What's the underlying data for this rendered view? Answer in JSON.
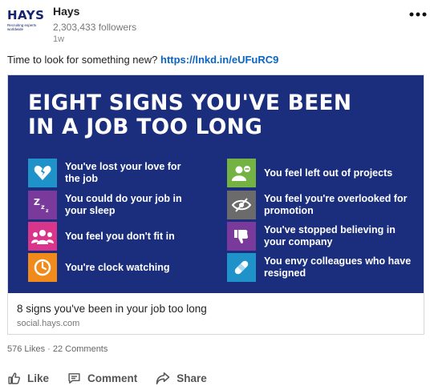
{
  "author": {
    "logo_word": "HAYS",
    "logo_tagline": "Recruiting experts worldwide",
    "name": "Hays",
    "followers": "2,303,433 followers",
    "age": "1w",
    "menu_icon": "more-horizontal-icon"
  },
  "post": {
    "text": "Time to look for something new?",
    "link": "https://lnkd.in/eUFuRC9"
  },
  "graphic": {
    "title_line1": "EIGHT SIGNS YOU'VE BEEN",
    "title_line2": "IN A JOB TOO LONG",
    "background_color": "#1a2e7d",
    "signs": [
      {
        "text": "You've lost your love for the job",
        "icon": "broken-heart-icon",
        "color": "#1f93c9"
      },
      {
        "text": "You could do your job in your sleep",
        "icon": "sleep-zzz-icon",
        "color": "#7a3a9b"
      },
      {
        "text": "You feel you don't fit in",
        "icon": "group-people-icon",
        "color": "#d9368b"
      },
      {
        "text": "You're clock watching",
        "icon": "clock-icon",
        "color": "#f08a1a"
      },
      {
        "text": "You feel left out of projects",
        "icon": "remove-user-icon",
        "color": "#74b244"
      },
      {
        "text": "You feel you're overlooked for promotion",
        "icon": "hidden-eye-icon",
        "color": "#6b6b6b"
      },
      {
        "text": "You've stopped believing in your company",
        "icon": "thumbs-down-icon",
        "color": "#7a3a9b"
      },
      {
        "text": "You envy colleagues who have resigned",
        "icon": "bandage-icon",
        "color": "#1f93c9"
      }
    ]
  },
  "card": {
    "title": "8 signs you've been in your job too long",
    "domain": "social.hays.com"
  },
  "social": {
    "likes": "576 Likes",
    "separator": "·",
    "comments": "22 Comments"
  },
  "actions": {
    "like": "Like",
    "comment": "Comment",
    "share": "Share"
  }
}
